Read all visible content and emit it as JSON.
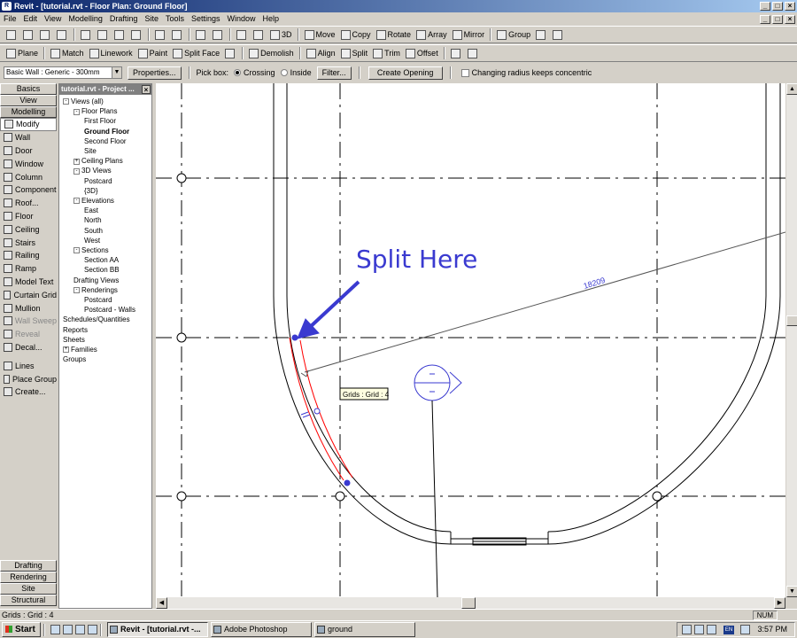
{
  "window": {
    "title": "Revit - [tutorial.rvt - Floor Plan: Ground Floor]",
    "app_icon": "revit-icon",
    "controls": [
      "_",
      "□",
      "×"
    ]
  },
  "menu": [
    "File",
    "Edit",
    "View",
    "Modelling",
    "Drafting",
    "Site",
    "Tools",
    "Settings",
    "Window",
    "Help"
  ],
  "toolbar1": {
    "items": [
      "Move",
      "Copy",
      "Rotate",
      "Array",
      "Mirror",
      "Group"
    ],
    "view3d": "3D"
  },
  "toolbar2": {
    "items": [
      "Plane",
      "Match",
      "Linework",
      "Paint",
      "Split Face",
      "Demolish",
      "Align",
      "Split",
      "Trim",
      "Offset"
    ]
  },
  "options": {
    "type_selector": "Basic Wall : Generic - 300mm",
    "properties_button": "Properties...",
    "pick_box_label": "Pick box:",
    "crossing": "Crossing",
    "inside": "Inside",
    "filter_button": "Filter...",
    "create_opening_button": "Create Opening",
    "concentric_check": "Changing radius keeps concentric"
  },
  "design_bar": {
    "tabs_top": [
      "Basics",
      "View",
      "Modelling"
    ],
    "tools": [
      {
        "label": "Modify",
        "icon": "arrow-cursor-icon"
      },
      {
        "label": "Wall",
        "icon": "wall-icon"
      },
      {
        "label": "Door",
        "icon": "door-icon"
      },
      {
        "label": "Window",
        "icon": "window-icon"
      },
      {
        "label": "Column",
        "icon": "column-icon"
      },
      {
        "label": "Component",
        "icon": "component-icon"
      },
      {
        "label": "Roof...",
        "icon": "roof-icon"
      },
      {
        "label": "Floor",
        "icon": "floor-icon"
      },
      {
        "label": "Ceiling",
        "icon": "ceiling-icon"
      },
      {
        "label": "Stairs",
        "icon": "stairs-icon"
      },
      {
        "label": "Railing",
        "icon": "railing-icon"
      },
      {
        "label": "Ramp",
        "icon": "ramp-icon"
      },
      {
        "label": "Model Text",
        "icon": "text-icon"
      },
      {
        "label": "Curtain Grid",
        "icon": "curtain-grid-icon"
      },
      {
        "label": "Mullion",
        "icon": "mullion-icon"
      },
      {
        "label": "Wall Sweep",
        "icon": "wall-sweep-icon"
      },
      {
        "label": "Reveal",
        "icon": "reveal-icon"
      },
      {
        "label": "Decal...",
        "icon": "decal-icon"
      },
      {
        "label": "Lines",
        "icon": "lines-icon"
      },
      {
        "label": "Place Group",
        "icon": "place-group-icon"
      },
      {
        "label": "Create...",
        "icon": "create-icon"
      }
    ],
    "tabs_bottom": [
      "Drafting",
      "Rendering",
      "Site",
      "Structural"
    ]
  },
  "project_browser": {
    "header": "tutorial.rvt - Project ...",
    "nodes": [
      {
        "label": "Views (all)"
      },
      {
        "label": "Floor Plans"
      },
      {
        "label": "First Floor"
      },
      {
        "label": "Ground Floor"
      },
      {
        "label": "Second Floor"
      },
      {
        "label": "Site"
      },
      {
        "label": "Ceiling Plans"
      },
      {
        "label": "3D Views"
      },
      {
        "label": "Postcard"
      },
      {
        "label": "{3D}"
      },
      {
        "label": "Elevations"
      },
      {
        "label": "East"
      },
      {
        "label": "North"
      },
      {
        "label": "South"
      },
      {
        "label": "West"
      },
      {
        "label": "Sections"
      },
      {
        "label": "Section AA"
      },
      {
        "label": "Section BB"
      },
      {
        "label": "Drafting Views"
      },
      {
        "label": "Renderings"
      },
      {
        "label": "Postcard"
      },
      {
        "label": "Postcard - Walls"
      },
      {
        "label": "Schedules/Quantities"
      },
      {
        "label": "Reports"
      },
      {
        "label": "Sheets"
      },
      {
        "label": "Families"
      },
      {
        "label": "Groups"
      }
    ]
  },
  "drawing": {
    "annotation": "Split Here",
    "dimension": "18209",
    "tooltip": "Grids : Grid : 4",
    "highlight_color": "#ff0000",
    "annotation_color": "#3a3ad0",
    "grid_color": "#000000"
  },
  "status": {
    "text": "Grids : Grid : 4",
    "num": "NUM"
  },
  "taskbar": {
    "start": "Start",
    "tasks": [
      "Revit - [tutorial.rvt -...",
      "Adobe Photoshop",
      "ground"
    ],
    "lang": "EN",
    "clock": "3:57 PM"
  }
}
